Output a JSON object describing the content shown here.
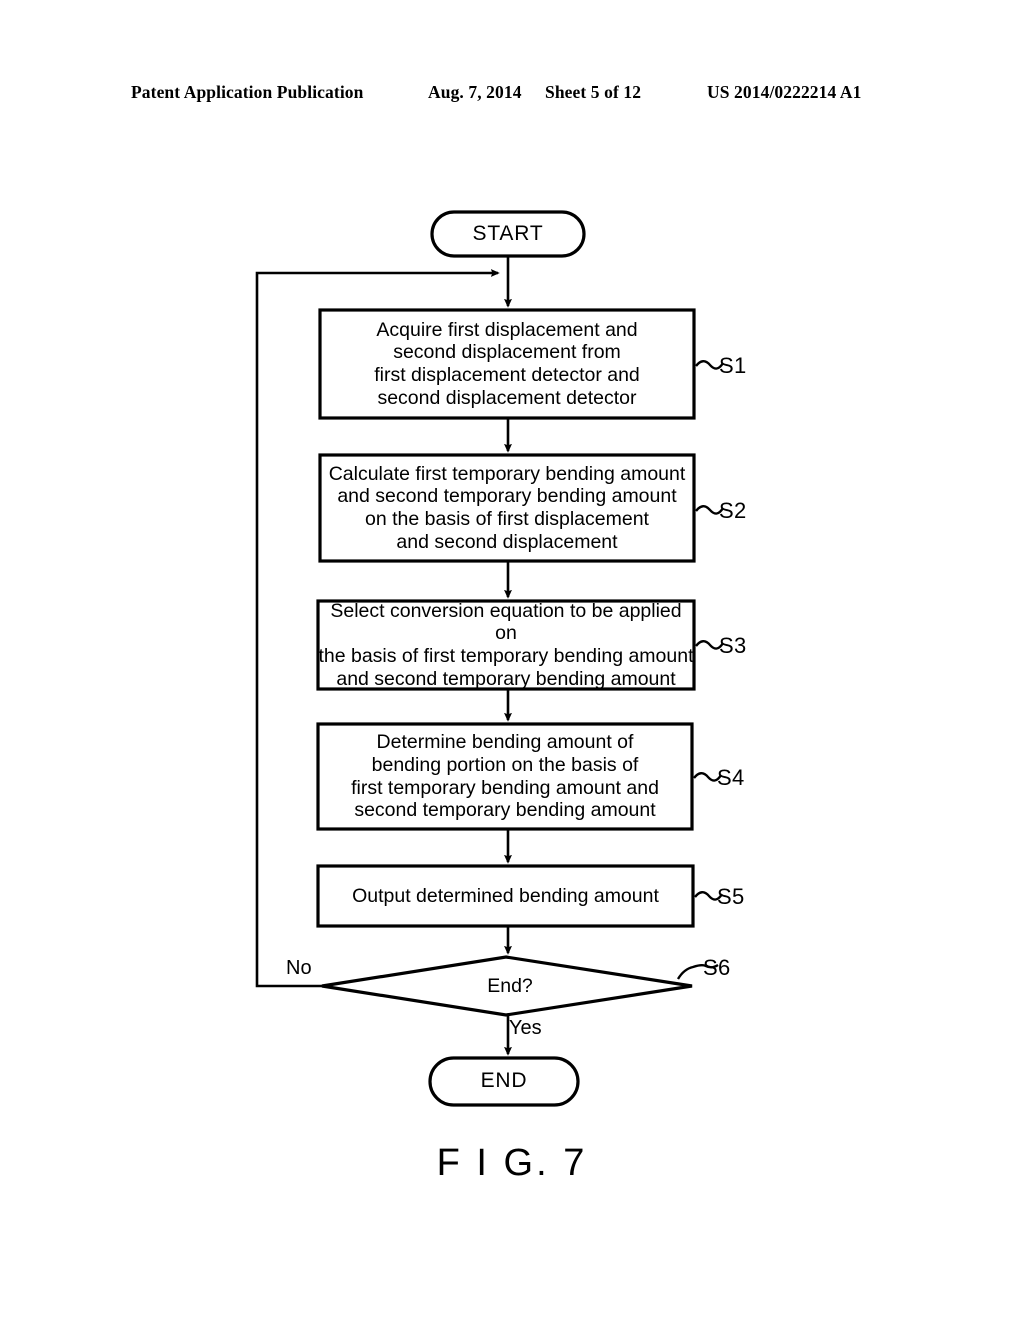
{
  "header": {
    "publication": "Patent Application Publication",
    "date": "Aug. 7, 2014",
    "sheet": "Sheet 5 of 12",
    "patent_number": "US 2014/0222214 A1"
  },
  "figure": {
    "caption": "F I G. 7",
    "type": "flowchart"
  },
  "flowchart": {
    "nodes": [
      {
        "id": "start",
        "shape": "terminator",
        "label": "START",
        "step": ""
      },
      {
        "id": "s1",
        "shape": "process",
        "label": "Acquire first displacement and\nsecond displacement from\nfirst displacement detector and\nsecond displacement detector",
        "step": "S1"
      },
      {
        "id": "s2",
        "shape": "process",
        "label": "Calculate first temporary bending amount\nand second temporary bending amount\non the basis of first displacement\nand second displacement",
        "step": "S2"
      },
      {
        "id": "s3",
        "shape": "process",
        "label": "Select conversion equation to be applied on\nthe basis of first temporary bending amount\nand second temporary bending amount",
        "step": "S3"
      },
      {
        "id": "s4",
        "shape": "process",
        "label": "Determine bending amount of\nbending portion on the basis of\nfirst temporary bending amount and\nsecond temporary bending amount",
        "step": "S4"
      },
      {
        "id": "s5",
        "shape": "process",
        "label": "Output determined bending amount",
        "step": "S5"
      },
      {
        "id": "s6",
        "shape": "decision",
        "label": "End?",
        "step": "S6"
      },
      {
        "id": "end",
        "shape": "terminator",
        "label": "END",
        "step": ""
      }
    ],
    "branches": {
      "no_label": "No",
      "yes_label": "Yes"
    },
    "colors": {
      "stroke": "#000000",
      "fill": "#ffffff",
      "text": "#000000"
    }
  }
}
